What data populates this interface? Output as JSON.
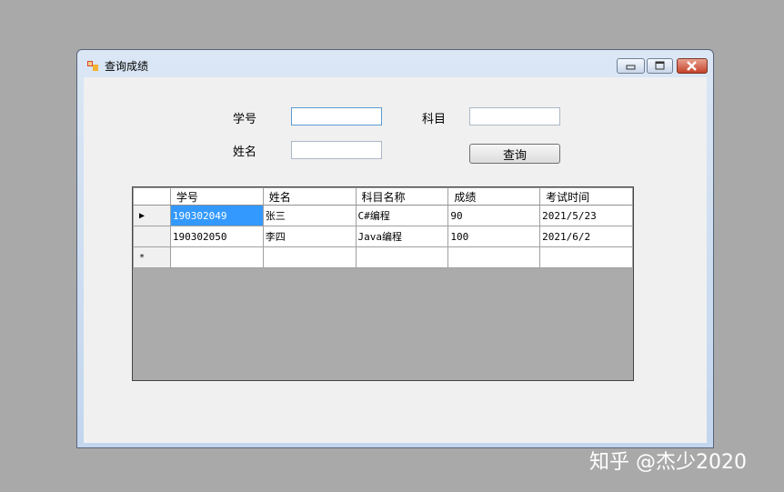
{
  "window": {
    "title": "查询成绩"
  },
  "form": {
    "student_id_label": "学号",
    "student_id_value": "",
    "name_label": "姓名",
    "name_value": "",
    "subject_label": "科目",
    "subject_value": "",
    "query_button": "查询"
  },
  "grid": {
    "columns": [
      "学号",
      "姓名",
      "科目名称",
      "成绩",
      "考试时间"
    ],
    "rows": [
      {
        "indicator": "▶",
        "cells": [
          "190302049",
          "张三",
          "C#编程",
          "90",
          "2021/5/23"
        ]
      },
      {
        "indicator": "",
        "cells": [
          "190302050",
          "李四",
          "Java编程",
          "100",
          "2021/6/2"
        ]
      },
      {
        "indicator": "*",
        "cells": [
          "",
          "",
          "",
          "",
          ""
        ]
      }
    ]
  },
  "watermark": "知乎 @杰少2020",
  "colors": {
    "selection": "#3399ff",
    "background": "#a9a9a9"
  }
}
